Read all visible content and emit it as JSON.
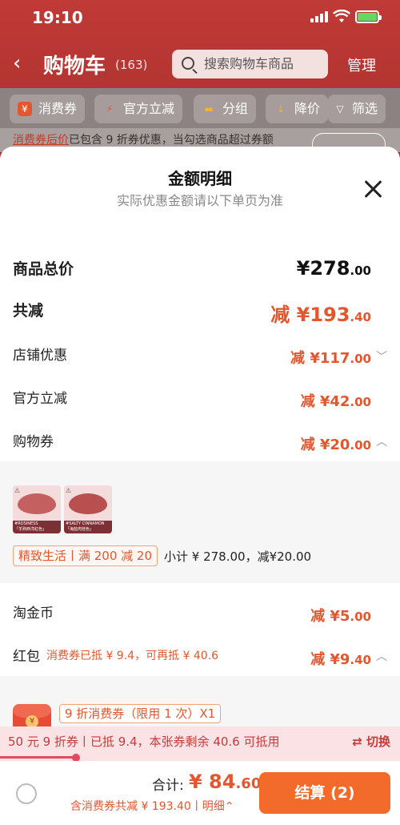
{
  "status": {
    "time": "19:10"
  },
  "nav": {
    "back_icon": "‹",
    "title": "购物车",
    "count": "(163)",
    "search_placeholder": "搜索购物车商品",
    "manage": "管理"
  },
  "filters": [
    {
      "icon": "coupon-icon",
      "glyph": "¥",
      "label": "消费券"
    },
    {
      "icon": "lightning-icon",
      "glyph": "⚡",
      "label": "官方立减"
    },
    {
      "icon": "folder-icon",
      "glyph": "▬",
      "label": "分组"
    },
    {
      "icon": "down-arrow-icon",
      "glyph": "↓",
      "label": "降价"
    },
    {
      "icon": "filter-icon",
      "glyph": "▽",
      "label": "筛选"
    }
  ],
  "notice": {
    "highlight": "消费券后价",
    "text": "已包含 9 折券优惠，当勾选商品超过券额"
  },
  "sheet": {
    "title": "金额明细",
    "subtitle": "实际优惠金额请以下单页为准",
    "total": {
      "label": "商品总价",
      "value": "¥278",
      "decimals": ".00"
    },
    "discount": {
      "label": "共减",
      "value": "减 ¥193",
      "decimals": ".40"
    },
    "store": {
      "label": "店铺优惠",
      "value": "减 ¥117",
      "decimals": ".00"
    },
    "official": {
      "label": "官方立减",
      "value": "减 ¥42",
      "decimals": ".00"
    },
    "voucher": {
      "label": "购物券",
      "value": "减 ¥20",
      "decimals": ".00"
    },
    "products": [
      {
        "name": "#ROSINESS",
        "sub": "「羊熟西洋紅色」",
        "lip_color": "#c4605f"
      },
      {
        "name": "#SALTY CINNAMON",
        "sub": "「海盐肉桂色」",
        "lip_color": "#b85050"
      }
    ],
    "promo_tag": "精致生活丨满 200 减 20",
    "subtotal": "小计 ¥ 278.00，减¥20.00",
    "gold": {
      "label": "淘金币",
      "value": "减 ¥5",
      "decimals": ".00"
    },
    "redpacket": {
      "label": "红包",
      "note": "消费券已抵 ¥ 9.4，可再抵 ¥ 40.6",
      "value": "减 ¥9",
      "decimals": ".40"
    },
    "coupon_tag": "9 折消费券（限用 1 次）X1"
  },
  "coupon_bar": {
    "text": "50 元 9 折券丨已抵 9.4，本张券剩余 40.6 可抵用",
    "switch": "⇄ 切换",
    "used_fraction": 0.19
  },
  "bottom": {
    "sum_label": "合计:",
    "sum_value": "¥ 84",
    "sum_decimals": ".60",
    "sum_sub": "含消费券共减 ¥ 193.40丨明细⌃",
    "checkout": "结算 (2)"
  },
  "colors": {
    "accent": "#e4572e",
    "checkout": "#f26b2a",
    "header": "#c03a36"
  }
}
